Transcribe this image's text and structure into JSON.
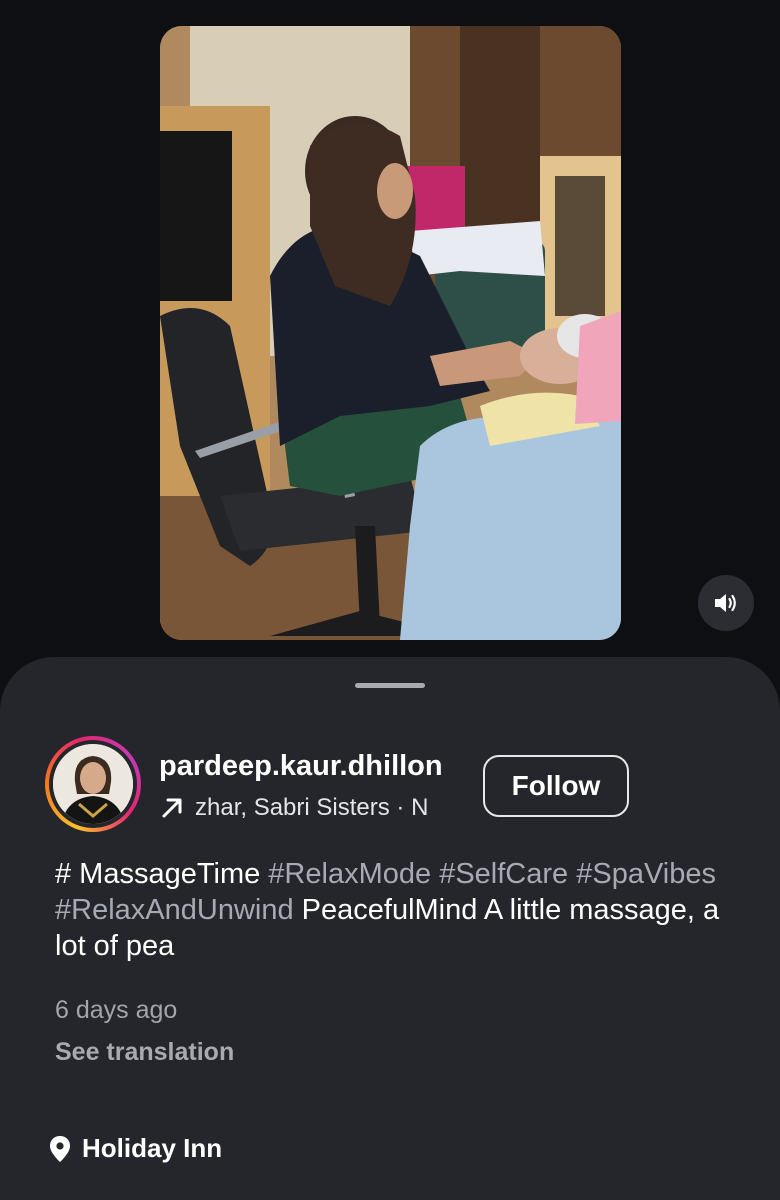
{
  "post": {
    "username": "pardeep.kaur.dhillon",
    "audio": "zhar, Sabri Sisters · N",
    "follow_label": "Follow",
    "caption": {
      "hash1": "# MassageTime",
      "tag_relaxmode": "#RelaxMode",
      "tag_selfcare": "#SelfCare",
      "tag_spavibes": "#SpaVibes",
      "tag_relaxandunwind": "#RelaxAndUnwind",
      "text_rest": "PeacefulMind A little massage, a lot of pea"
    },
    "timestamp": "6 days ago",
    "see_translation": "See translation",
    "location": "Holiday Inn"
  },
  "icons": {
    "sound": "volume-icon",
    "audio": "arrow-up-right-icon",
    "location": "location-pin-icon"
  },
  "colors": {
    "background": "#0d0f13",
    "sheet": "#25262b",
    "hashtag": "#a7aab2",
    "secondary_text": "#a3a5ab"
  }
}
